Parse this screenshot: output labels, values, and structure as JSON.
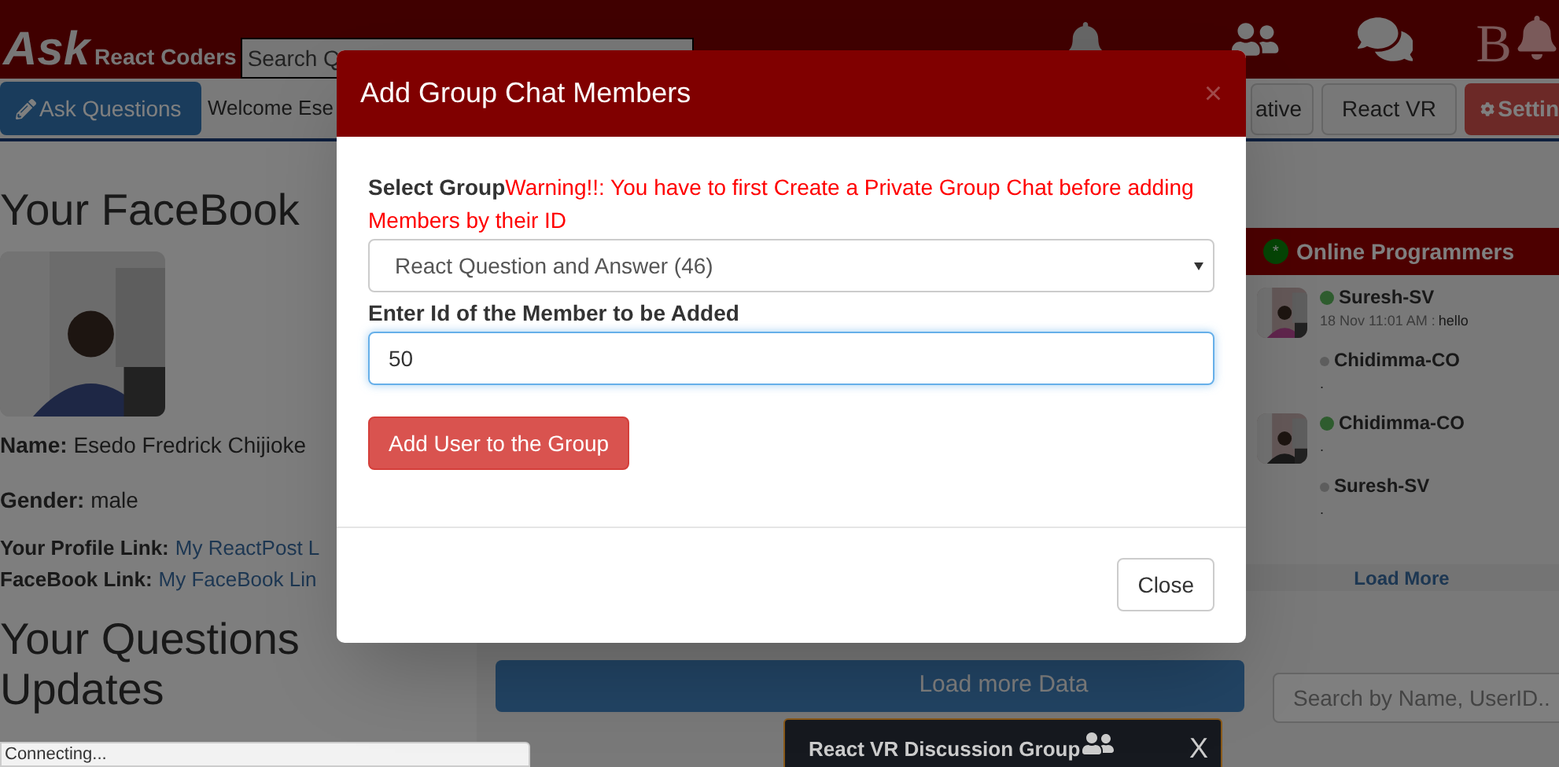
{
  "header": {
    "logo": "Ask",
    "subtitle": "React Coders",
    "search": {
      "placeholder": "Search Q"
    },
    "icon_letter": "B"
  },
  "nav": {
    "ask_button": "Ask Questions",
    "welcome": "Welcome Ese",
    "buttons": [
      {
        "label": "ative",
        "kind": "plain"
      },
      {
        "label": "React VR",
        "kind": "plain"
      },
      {
        "label": "Settin",
        "kind": "danger"
      }
    ]
  },
  "profile": {
    "title": "Your FaceBook",
    "fields": [
      {
        "label": "Name:",
        "value": "Esedo Fredrick Chijioke"
      },
      {
        "label": "Gender:",
        "value": "male"
      }
    ],
    "links": [
      {
        "label": "Your Profile Link:",
        "link": "My ReactPost L"
      },
      {
        "label": "FaceBook Link:",
        "link": "My FaceBook Lin"
      }
    ]
  },
  "questions_title": "Your Questions Updates",
  "load_more": "Load more Data",
  "online": {
    "title": "Online Programmers",
    "badge": "*",
    "users": [
      {
        "name": "Suresh-SV",
        "online": true,
        "kind": "avatar",
        "time": "18 Nov 11:01 AM :",
        "message": "hello"
      },
      {
        "name": "Chidimma-CO",
        "online": false,
        "kind": "plain",
        "message": "."
      },
      {
        "name": "Chidimma-CO",
        "online": true,
        "kind": "avatar",
        "message": "."
      },
      {
        "name": "Suresh-SV",
        "online": false,
        "kind": "plain",
        "message": "."
      }
    ],
    "load_more": "Load More",
    "search": {
      "placeholder": "Search by Name, UserID.."
    }
  },
  "chat": {
    "title": "React VR Discussion Group",
    "close": "X"
  },
  "status": "Connecting...",
  "modal": {
    "title": "Add Group Chat Members",
    "close": "×",
    "label": "Select Group",
    "warning": "Warning!!: You have to first Create a Private Group Chat before adding Members by their ID",
    "select": {
      "value": "React Question and Answer (46)"
    },
    "id_label": "Enter Id of the Member to be Added",
    "id_field": {
      "value": "50"
    },
    "submit": "Add User to the Group",
    "footer_button": "Close"
  }
}
